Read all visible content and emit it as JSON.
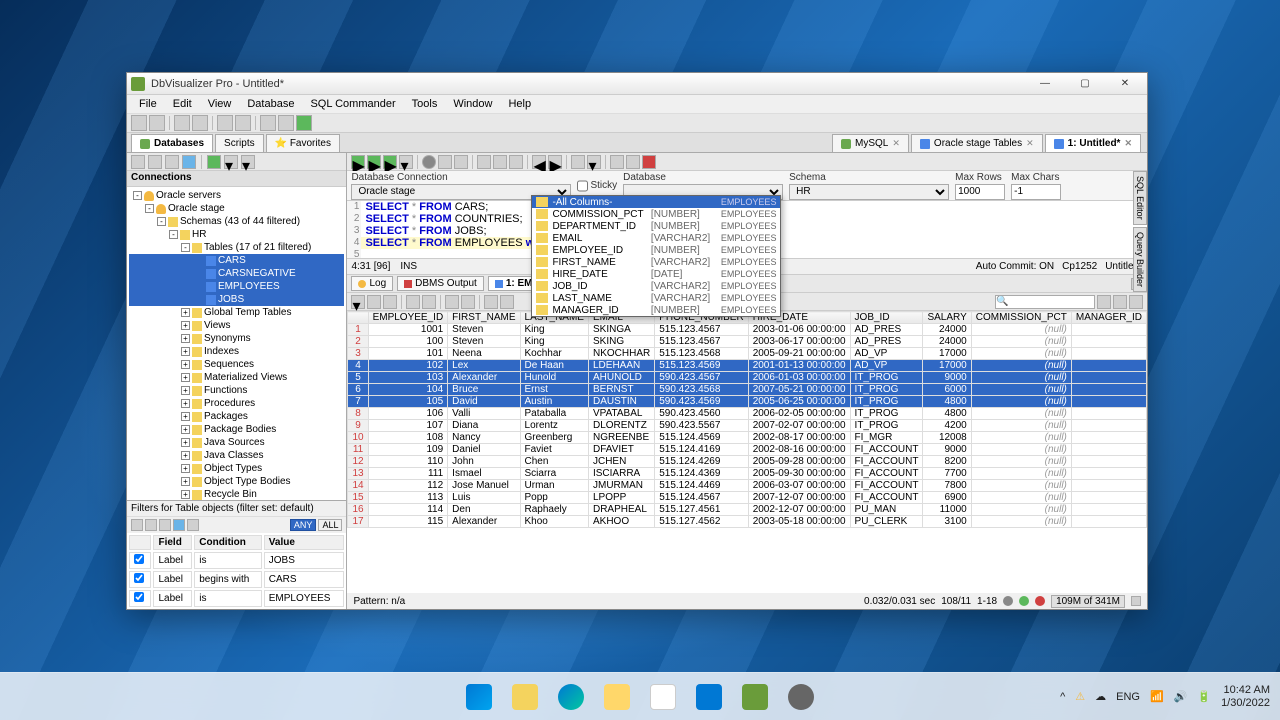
{
  "window": {
    "title": "DbVisualizer Pro - Untitled*"
  },
  "menu": [
    "File",
    "Edit",
    "View",
    "Database",
    "SQL Commander",
    "Tools",
    "Window",
    "Help"
  ],
  "doc_tabs": [
    {
      "label": "MySQL",
      "icon": "db"
    },
    {
      "label": "Oracle stage Tables",
      "icon": "tbl"
    },
    {
      "label": "1: Untitled*",
      "icon": "sql",
      "active": true
    }
  ],
  "connections_header": "Connections",
  "tree": {
    "root": "Oracle servers",
    "stage": "Oracle stage",
    "schemas": "Schemas   (43 of 44 filtered)",
    "hr": "HR",
    "tables_label": "Tables   (17 of 21 filtered)",
    "tables": [
      "CARS",
      "CARSNEGATIVE",
      "EMPLOYEES",
      "JOBS"
    ],
    "others": [
      "Global Temp Tables",
      "Views",
      "Synonyms",
      "Indexes",
      "Sequences",
      "Materialized Views",
      "Functions",
      "Procedures",
      "Packages",
      "Package Bodies",
      "Java Sources",
      "Java Classes",
      "Object Types",
      "Object Type Bodies",
      "Recycle Bin"
    ]
  },
  "filter_label": "Filters for Table objects (filter set: default)",
  "filter_btns": {
    "any": "ANY",
    "all": "ALL"
  },
  "filter_cols": [
    "",
    "Field",
    "Condition",
    "Value"
  ],
  "filter_rows": [
    {
      "field": "Label",
      "cond": "is",
      "value": "JOBS"
    },
    {
      "field": "Label",
      "cond": "begins with",
      "value": "CARS"
    },
    {
      "field": "Label",
      "cond": "is",
      "value": "EMPLOYEES"
    }
  ],
  "conn": {
    "db_conn_label": "Database Connection",
    "db_conn": "Oracle stage",
    "sticky": "Sticky",
    "database_label": "Database",
    "database": "",
    "schema_label": "Schema",
    "schema": "HR",
    "maxrows_label": "Max Rows",
    "maxrows": "1000",
    "maxchars_label": "Max Chars",
    "maxchars": "-1"
  },
  "sql": [
    "SELECT * FROM CARS;",
    "SELECT * FROM COUNTRIES;",
    "SELECT * FROM JOBS;",
    "SELECT * FROM EMPLOYEES where "
  ],
  "autocomplete": {
    "header": "-All Columns-",
    "header_tbl": "EMPLOYEES",
    "items": [
      {
        "name": "COMMISSION_PCT",
        "type": "[NUMBER]",
        "tbl": "EMPLOYEES"
      },
      {
        "name": "DEPARTMENT_ID",
        "type": "[NUMBER]",
        "tbl": "EMPLOYEES"
      },
      {
        "name": "EMAIL",
        "type": "[VARCHAR2]",
        "tbl": "EMPLOYEES"
      },
      {
        "name": "EMPLOYEE_ID",
        "type": "[NUMBER]",
        "tbl": "EMPLOYEES"
      },
      {
        "name": "FIRST_NAME",
        "type": "[VARCHAR2]",
        "tbl": "EMPLOYEES"
      },
      {
        "name": "HIRE_DATE",
        "type": "[DATE]",
        "tbl": "EMPLOYEES"
      },
      {
        "name": "JOB_ID",
        "type": "[VARCHAR2]",
        "tbl": "EMPLOYEES"
      },
      {
        "name": "LAST_NAME",
        "type": "[VARCHAR2]",
        "tbl": "EMPLOYEES"
      },
      {
        "name": "MANAGER_ID",
        "type": "[NUMBER]",
        "tbl": "EMPLOYEES"
      }
    ]
  },
  "editor_status": {
    "pos": "4:31 [96]",
    "ins": "INS",
    "autocommit": "Auto Commit: ON",
    "encoding": "Cp1252",
    "file": "Untitled*"
  },
  "result_tabs": {
    "log": "Log",
    "dbms": "DBMS Output",
    "active": "1: EMPLOY..."
  },
  "grid_cols": [
    "",
    "EMPLOYEE_ID",
    "FIRST_NAME",
    "LAST_NAME",
    "EMAIL",
    "PHONE_NUMBER",
    "HIRE_DATE",
    "JOB_ID",
    "SALARY",
    "COMMISSION_PCT",
    "MANAGER_ID"
  ],
  "grid_rows": [
    {
      "n": 1,
      "id": 1001,
      "fn": "Steven",
      "ln": "King",
      "em": "SKINGA",
      "ph": "515.123.4567",
      "hd": "2003-01-06 00:00:00",
      "job": "AD_PRES",
      "sal": 24000,
      "cp": "(null)",
      "mg": ""
    },
    {
      "n": 2,
      "id": 100,
      "fn": "Steven",
      "ln": "King",
      "em": "SKING",
      "ph": "515.123.4567",
      "hd": "2003-06-17 00:00:00",
      "job": "AD_PRES",
      "sal": 24000,
      "cp": "(null)",
      "mg": ""
    },
    {
      "n": 3,
      "id": 101,
      "fn": "Neena",
      "ln": "Kochhar",
      "em": "NKOCHHAR",
      "ph": "515.123.4568",
      "hd": "2005-09-21 00:00:00",
      "job": "AD_VP",
      "sal": 17000,
      "cp": "(null)",
      "mg": ""
    },
    {
      "n": 4,
      "id": 102,
      "fn": "Lex",
      "ln": "De Haan",
      "em": "LDEHAAN",
      "ph": "515.123.4569",
      "hd": "2001-01-13 00:00:00",
      "job": "AD_VP",
      "sal": 17000,
      "cp": "(null)",
      "mg": "",
      "sel": true
    },
    {
      "n": 5,
      "id": 103,
      "fn": "Alexander",
      "ln": "Hunold",
      "em": "AHUNOLD",
      "ph": "590.423.4567",
      "hd": "2006-01-03 00:00:00",
      "job": "IT_PROG",
      "sal": 9000,
      "cp": "(null)",
      "mg": "",
      "sel": true
    },
    {
      "n": 6,
      "id": 104,
      "fn": "Bruce",
      "ln": "Ernst",
      "em": "BERNST",
      "ph": "590.423.4568",
      "hd": "2007-05-21 00:00:00",
      "job": "IT_PROG",
      "sal": 6000,
      "cp": "(null)",
      "mg": "",
      "sel": true
    },
    {
      "n": 7,
      "id": 105,
      "fn": "David",
      "ln": "Austin",
      "em": "DAUSTIN",
      "ph": "590.423.4569",
      "hd": "2005-06-25 00:00:00",
      "job": "IT_PROG",
      "sal": 4800,
      "cp": "(null)",
      "mg": "",
      "sel": true
    },
    {
      "n": 8,
      "id": 106,
      "fn": "Valli",
      "ln": "Pataballa",
      "em": "VPATABAL",
      "ph": "590.423.4560",
      "hd": "2006-02-05 00:00:00",
      "job": "IT_PROG",
      "sal": 4800,
      "cp": "(null)",
      "mg": ""
    },
    {
      "n": 9,
      "id": 107,
      "fn": "Diana",
      "ln": "Lorentz",
      "em": "DLORENTZ",
      "ph": "590.423.5567",
      "hd": "2007-02-07 00:00:00",
      "job": "IT_PROG",
      "sal": 4200,
      "cp": "(null)",
      "mg": ""
    },
    {
      "n": 10,
      "id": 108,
      "fn": "Nancy",
      "ln": "Greenberg",
      "em": "NGREENBE",
      "ph": "515.124.4569",
      "hd": "2002-08-17 00:00:00",
      "job": "FI_MGR",
      "sal": 12008,
      "cp": "(null)",
      "mg": ""
    },
    {
      "n": 11,
      "id": 109,
      "fn": "Daniel",
      "ln": "Faviet",
      "em": "DFAVIET",
      "ph": "515.124.4169",
      "hd": "2002-08-16 00:00:00",
      "job": "FI_ACCOUNT",
      "sal": 9000,
      "cp": "(null)",
      "mg": ""
    },
    {
      "n": 12,
      "id": 110,
      "fn": "John",
      "ln": "Chen",
      "em": "JCHEN",
      "ph": "515.124.4269",
      "hd": "2005-09-28 00:00:00",
      "job": "FI_ACCOUNT",
      "sal": 8200,
      "cp": "(null)",
      "mg": ""
    },
    {
      "n": 13,
      "id": 111,
      "fn": "Ismael",
      "ln": "Sciarra",
      "em": "ISCIARRA",
      "ph": "515.124.4369",
      "hd": "2005-09-30 00:00:00",
      "job": "FI_ACCOUNT",
      "sal": 7700,
      "cp": "(null)",
      "mg": ""
    },
    {
      "n": 14,
      "id": 112,
      "fn": "Jose Manuel",
      "ln": "Urman",
      "em": "JMURMAN",
      "ph": "515.124.4469",
      "hd": "2006-03-07 00:00:00",
      "job": "FI_ACCOUNT",
      "sal": 7800,
      "cp": "(null)",
      "mg": ""
    },
    {
      "n": 15,
      "id": 113,
      "fn": "Luis",
      "ln": "Popp",
      "em": "LPOPP",
      "ph": "515.124.4567",
      "hd": "2007-12-07 00:00:00",
      "job": "FI_ACCOUNT",
      "sal": 6900,
      "cp": "(null)",
      "mg": ""
    },
    {
      "n": 16,
      "id": 114,
      "fn": "Den",
      "ln": "Raphaely",
      "em": "DRAPHEAL",
      "ph": "515.127.4561",
      "hd": "2002-12-07 00:00:00",
      "job": "PU_MAN",
      "sal": 11000,
      "cp": "(null)",
      "mg": ""
    },
    {
      "n": 17,
      "id": 115,
      "fn": "Alexander",
      "ln": "Khoo",
      "em": "AKHOO",
      "ph": "515.127.4562",
      "hd": "2003-05-18 00:00:00",
      "job": "PU_CLERK",
      "sal": 3100,
      "cp": "(null)",
      "mg": ""
    }
  ],
  "grid_status": {
    "pattern": "Pattern: n/a",
    "time": "0.032/0.031 sec",
    "rows": "108/11",
    "range": "1-18",
    "mem": "109M of 341M"
  },
  "side_tabs": [
    "SQL Editor",
    "Query Builder"
  ],
  "tray": {
    "lang": "ENG",
    "time": "10:42 AM",
    "date": "1/30/2022"
  }
}
